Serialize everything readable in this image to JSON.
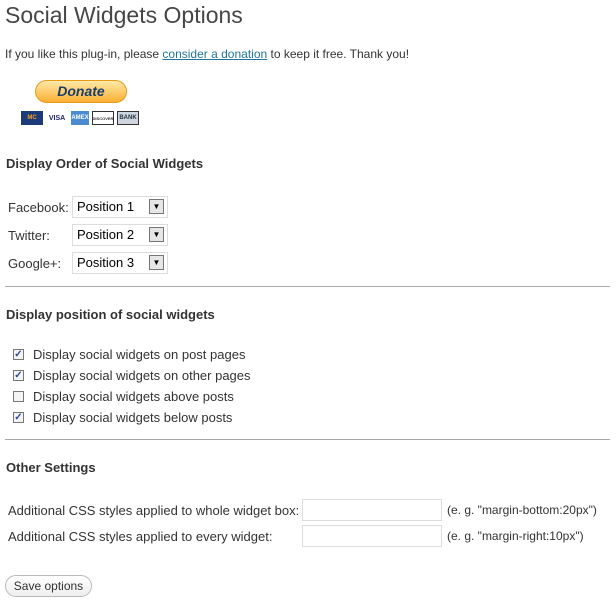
{
  "title": "Social Widgets Options",
  "intro": {
    "before": "If you like this plug-in, please ",
    "link": "consider a donation",
    "after": " to keep it free. Thank you!"
  },
  "donate": {
    "label": "Donate",
    "cards": [
      "MC",
      "VISA",
      "AMEX",
      "DISCOVER",
      "BANK"
    ]
  },
  "order": {
    "heading": "Display Order of Social Widgets",
    "rows": [
      {
        "label": "Facebook:",
        "value": "Position 1"
      },
      {
        "label": "Twitter:",
        "value": "Position 2"
      },
      {
        "label": "Google+:",
        "value": "Position 3"
      }
    ]
  },
  "position": {
    "heading": "Display position of social widgets",
    "items": [
      {
        "label": "Display social widgets on post pages",
        "checked": true
      },
      {
        "label": "Display social widgets on other pages",
        "checked": true
      },
      {
        "label": "Display social widgets above posts",
        "checked": false
      },
      {
        "label": "Display social widgets below posts",
        "checked": true
      }
    ]
  },
  "other": {
    "heading": "Other Settings",
    "rows": [
      {
        "label": "Additional CSS styles applied to whole widget box:",
        "value": "",
        "hint": "(e. g. \"margin-bottom:20px\")"
      },
      {
        "label": "Additional CSS styles applied to every widget:",
        "value": "",
        "hint": "(e. g. \"margin-right:10px\")"
      }
    ]
  },
  "save_label": "Save options"
}
